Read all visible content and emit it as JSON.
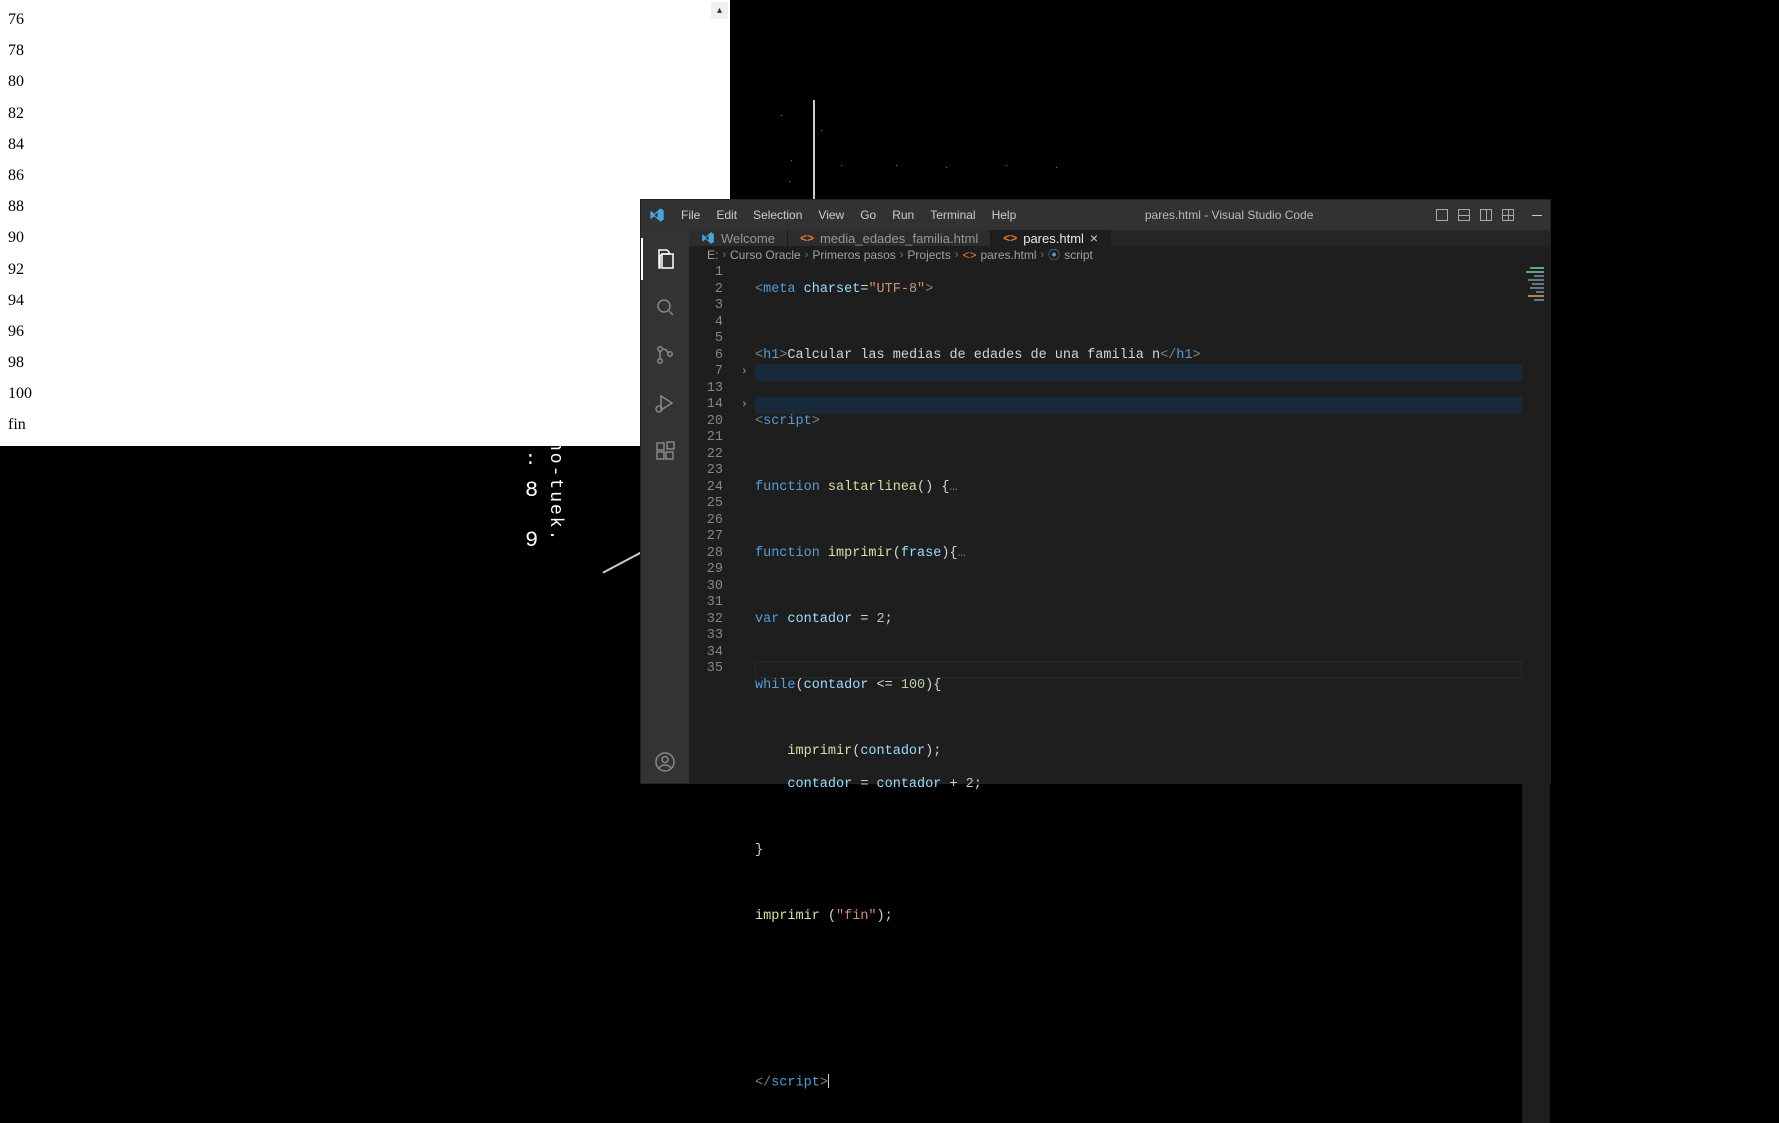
{
  "browser": {
    "values": [
      "76",
      "78",
      "80",
      "82",
      "84",
      "86",
      "88",
      "90",
      "92",
      "94",
      "96",
      "98",
      "100",
      "fin"
    ]
  },
  "desktop": {
    "vtext": "no-tuek.",
    "n8": "8",
    "n9": "9",
    "colon": ":"
  },
  "vscode": {
    "title": "pares.html - Visual Studio Code",
    "menu": [
      "File",
      "Edit",
      "Selection",
      "View",
      "Go",
      "Run",
      "Terminal",
      "Help"
    ],
    "tabs": [
      {
        "label": "Welcome",
        "kind": "welcome",
        "active": false
      },
      {
        "label": "media_edades_familia.html",
        "kind": "html",
        "active": false
      },
      {
        "label": "pares.html",
        "kind": "html",
        "active": true
      }
    ],
    "breadcrumbs": [
      "E:",
      "Curso Oracle",
      "Primeros pasos",
      "Projects",
      "pares.html",
      "script"
    ],
    "gutter": [
      "1",
      "2",
      "3",
      "4",
      "5",
      "6",
      "7",
      "13",
      "14",
      "20",
      "21",
      "22",
      "23",
      "24",
      "25",
      "26",
      "27",
      "28",
      "29",
      "30",
      "31",
      "32",
      "33",
      "34",
      "35"
    ],
    "fold": {
      "l7": "›",
      "l14": "›"
    },
    "code": {
      "l1": {
        "a": "<",
        "b": "meta ",
        "c": "charset",
        "d": "=",
        "e": "\"UTF-8\"",
        "f": ">"
      },
      "l3": {
        "a": "<",
        "b": "h1",
        "c": ">",
        "d": "Calcular las medias de edades de una familia n",
        "e": "</",
        "f": "h1",
        "g": ">"
      },
      "l5": {
        "a": "<",
        "b": "script",
        "c": ">"
      },
      "l7": {
        "a": "function ",
        "b": "saltarlinea",
        "c": "() {",
        "d": "…"
      },
      "l14": {
        "a": "function ",
        "b": "imprimir",
        "c": "(",
        "d": "frase",
        "e": "){",
        "f": "…"
      },
      "l21": {
        "a": "var ",
        "b": "contador",
        "c": " = ",
        "d": "2",
        "e": ";"
      },
      "l23": {
        "a": "while",
        "b": "(",
        "c": "contador",
        "d": " <= ",
        "e": "100",
        "f": "){"
      },
      "l25": {
        "a": "imprimir",
        "b": "(",
        "c": "contador",
        "d": ");"
      },
      "l26": {
        "a": "contador",
        "b": " = ",
        "c": "contador",
        "d": " + ",
        "e": "2",
        "f": ";"
      },
      "l28": {
        "a": "}"
      },
      "l30": {
        "a": "imprimir ",
        "b": "(",
        "c": "\"fin\"",
        "d": ");"
      },
      "l35": {
        "a": "</",
        "b": "script",
        "c": ">"
      }
    }
  }
}
